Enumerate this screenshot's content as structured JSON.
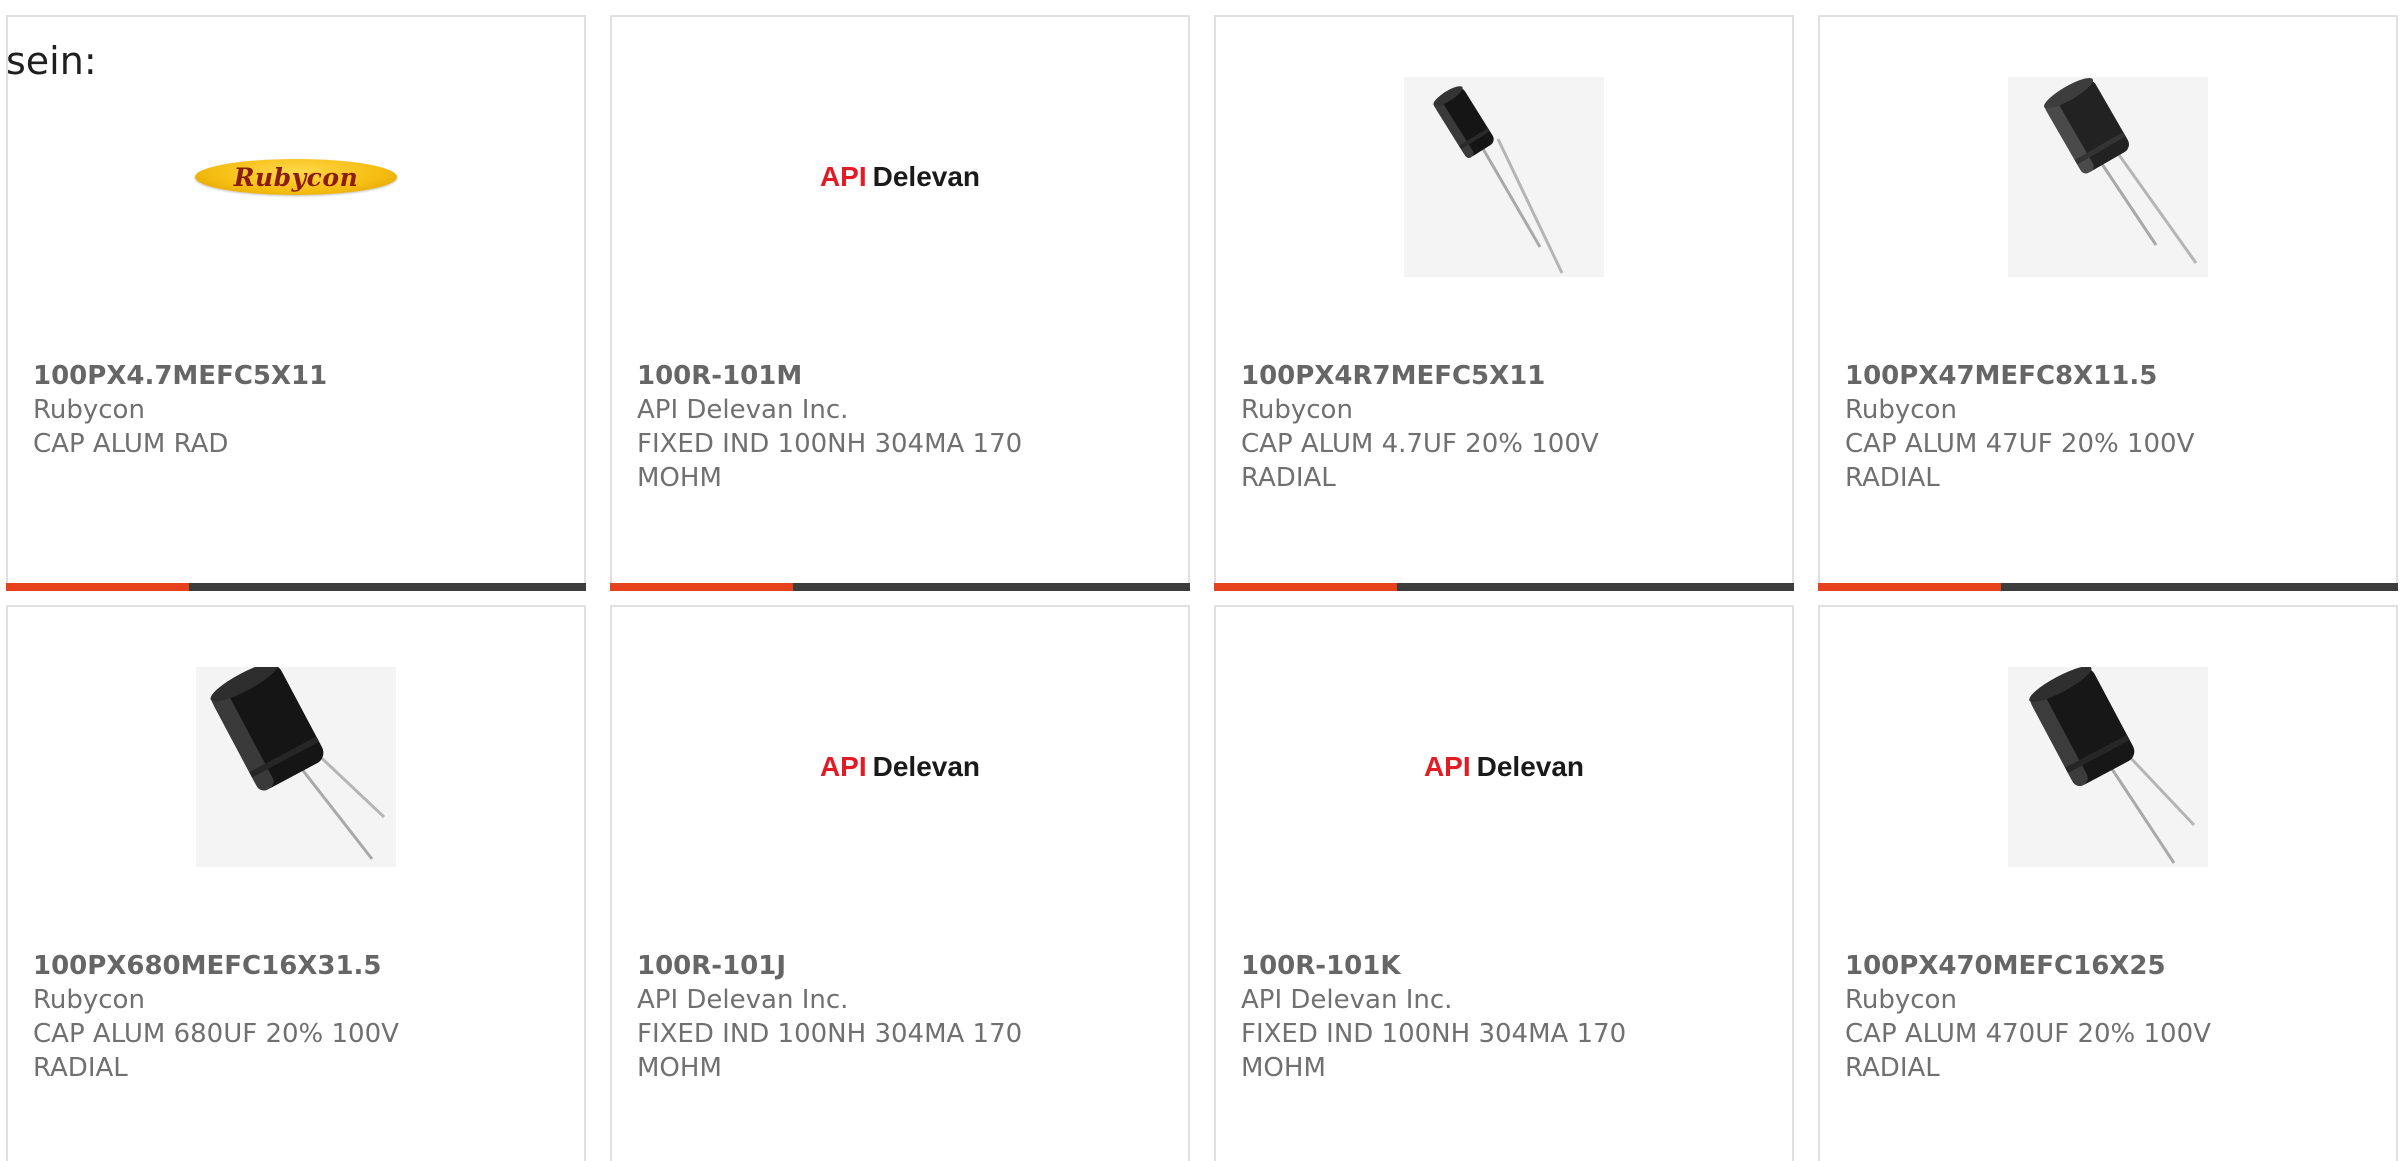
{
  "intro_text": "sein:",
  "colors": {
    "accent_bar": "#e8411d",
    "bar_dark": "#3d3d3d",
    "card_border": "#e0e0e0",
    "text": "#707070"
  },
  "products": [
    {
      "part_number": "100PX4.7MEFC5X11",
      "manufacturer": "Rubycon",
      "description": "CAP ALUM RAD",
      "image": "rubycon-logo",
      "logo_text": "Rubycon"
    },
    {
      "part_number": "100R-101M",
      "manufacturer": "API Delevan Inc.",
      "description": "FIXED IND 100NH 304MA 170 MOHM",
      "image": "api-delevan-logo",
      "logo_text_1": "API",
      "logo_text_2": "Delevan"
    },
    {
      "part_number": "100PX4R7MEFC5X11",
      "manufacturer": "Rubycon",
      "description": "CAP ALUM 4.7UF 20% 100V RADIAL",
      "image": "capacitor-photo"
    },
    {
      "part_number": "100PX47MEFC8X11.5",
      "manufacturer": "Rubycon",
      "description": "CAP ALUM 47UF 20% 100V RADIAL",
      "image": "capacitor-photo"
    },
    {
      "part_number": "100PX680MEFC16X31.5",
      "manufacturer": "Rubycon",
      "description": "CAP ALUM 680UF 20% 100V RADIAL",
      "image": "capacitor-photo"
    },
    {
      "part_number": "100R-101J",
      "manufacturer": "API Delevan Inc.",
      "description": "FIXED IND 100NH 304MA 170 MOHM",
      "image": "api-delevan-logo",
      "logo_text_1": "API",
      "logo_text_2": "Delevan"
    },
    {
      "part_number": "100R-101K",
      "manufacturer": "API Delevan Inc.",
      "description": "FIXED IND 100NH 304MA 170 MOHM",
      "image": "api-delevan-logo",
      "logo_text_1": "API",
      "logo_text_2": "Delevan"
    },
    {
      "part_number": "100PX470MEFC16X25",
      "manufacturer": "Rubycon",
      "description": "CAP ALUM 470UF 20% 100V RADIAL",
      "image": "capacitor-photo"
    }
  ]
}
